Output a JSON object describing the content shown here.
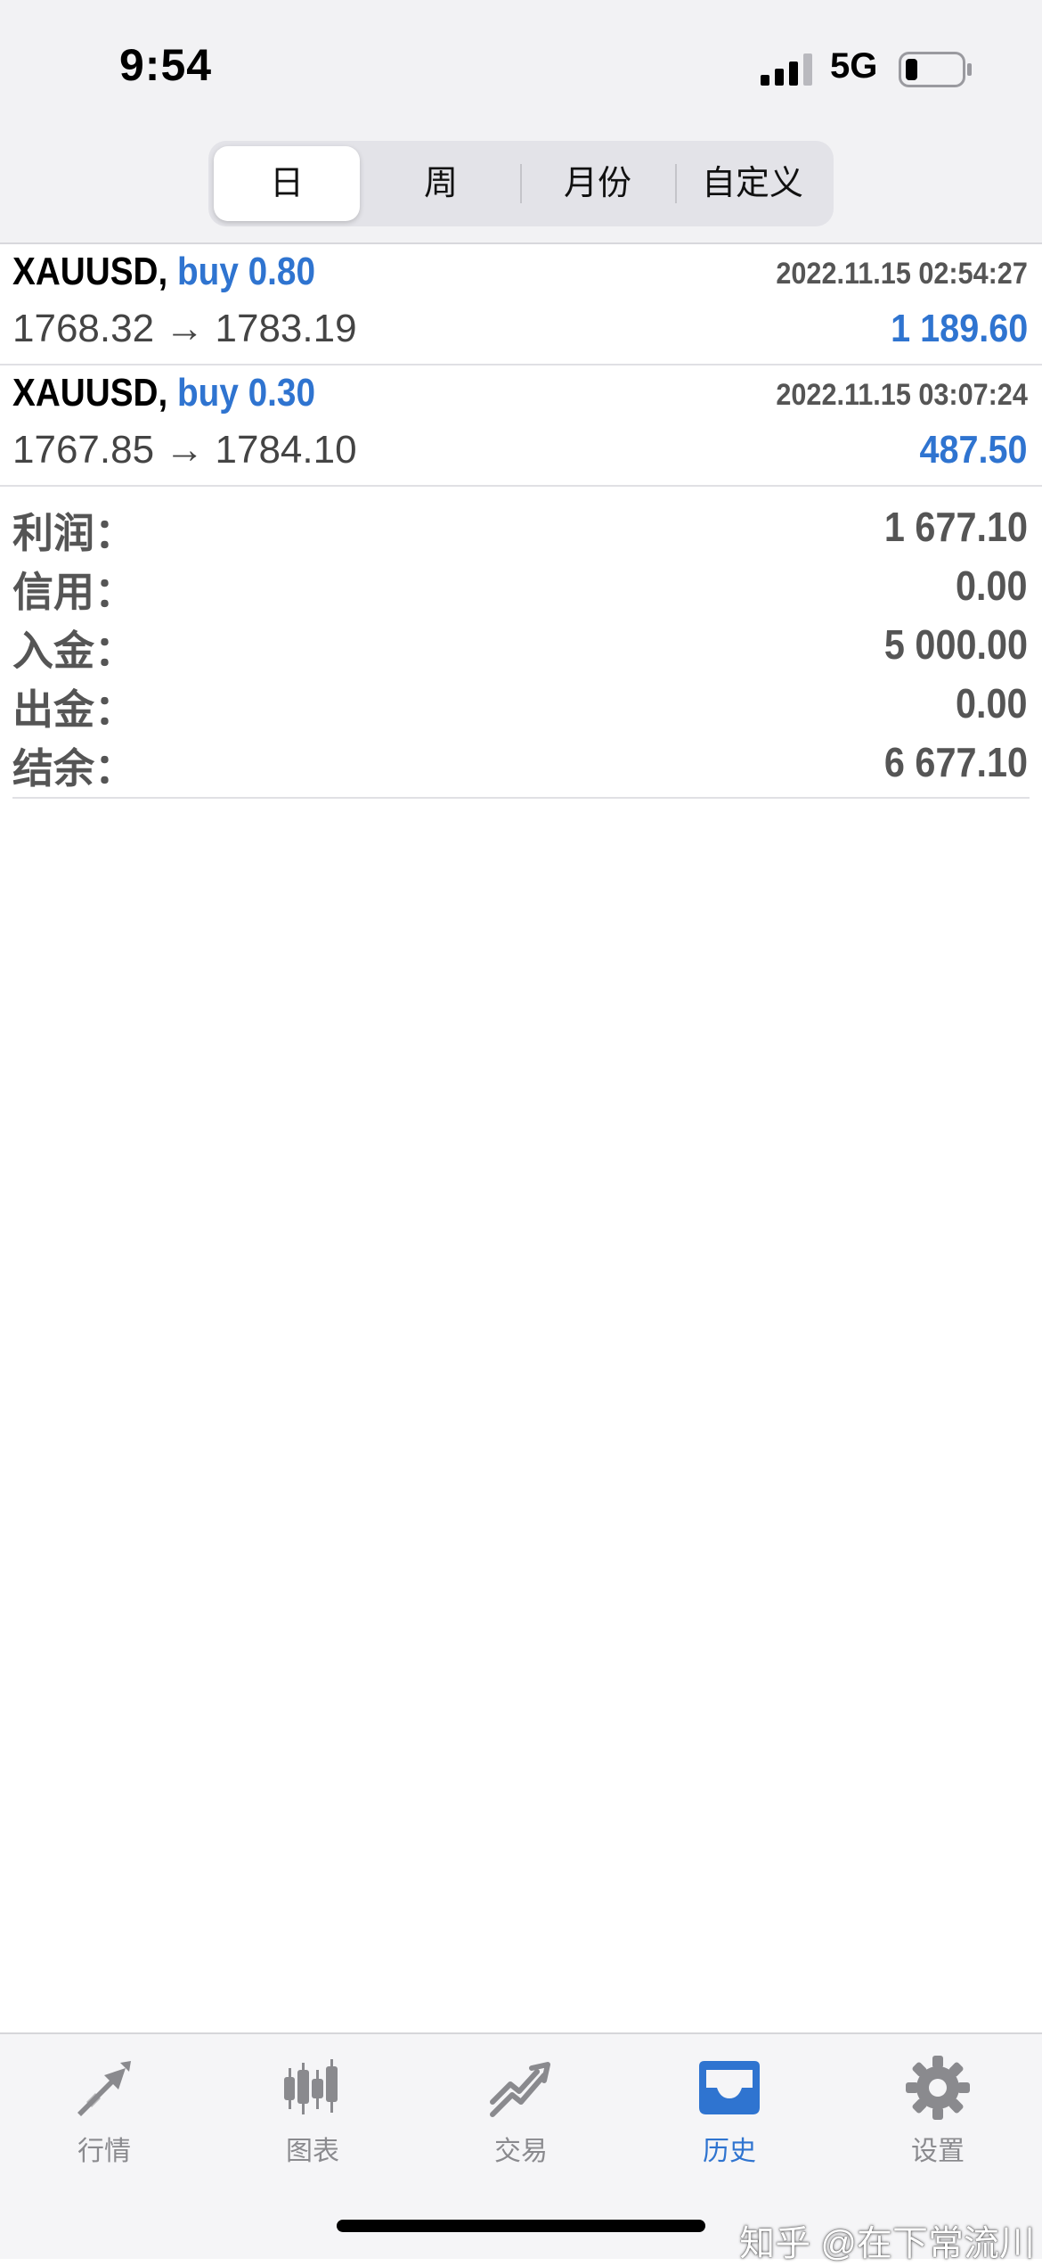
{
  "status_bar": {
    "time": "9:54",
    "network": "5G",
    "signal_icon": "cellular-signal-icon",
    "battery_icon": "battery-low-icon"
  },
  "period_tabs": {
    "items": [
      {
        "label": "日",
        "selected": true
      },
      {
        "label": "周",
        "selected": false
      },
      {
        "label": "月份",
        "selected": false
      },
      {
        "label": "自定义",
        "selected": false
      }
    ]
  },
  "trades": [
    {
      "symbol": "XAUUSD,",
      "side": "buy 0.80",
      "time": "2022.11.15 02:54:27",
      "prices": "1768.32 → 1783.19",
      "profit": "1 189.60"
    },
    {
      "symbol": "XAUUSD,",
      "side": "buy 0.30",
      "time": "2022.11.15 03:07:24",
      "prices": "1767.85 → 1784.10",
      "profit": "487.50"
    }
  ],
  "summary": [
    {
      "label": "利润：",
      "value": "1 677.10"
    },
    {
      "label": "信用：",
      "value": "0.00"
    },
    {
      "label": "入金：",
      "value": "5 000.00"
    },
    {
      "label": "出金：",
      "value": "0.00"
    },
    {
      "label": "结余：",
      "value": "6 677.10"
    }
  ],
  "tab_bar": {
    "items": [
      {
        "label": "行情",
        "icon": "quotes-arrows-icon",
        "active": false
      },
      {
        "label": "图表",
        "icon": "candlestick-chart-icon",
        "active": false
      },
      {
        "label": "交易",
        "icon": "trade-trend-icon",
        "active": false
      },
      {
        "label": "历史",
        "icon": "history-inbox-icon",
        "active": true
      },
      {
        "label": "设置",
        "icon": "gear-icon",
        "active": false
      }
    ]
  },
  "watermark": "知乎 @在下常流川",
  "colors": {
    "accent": "#2f74d0",
    "inactive": "#8a8a8e",
    "summary_text": "#555555"
  }
}
